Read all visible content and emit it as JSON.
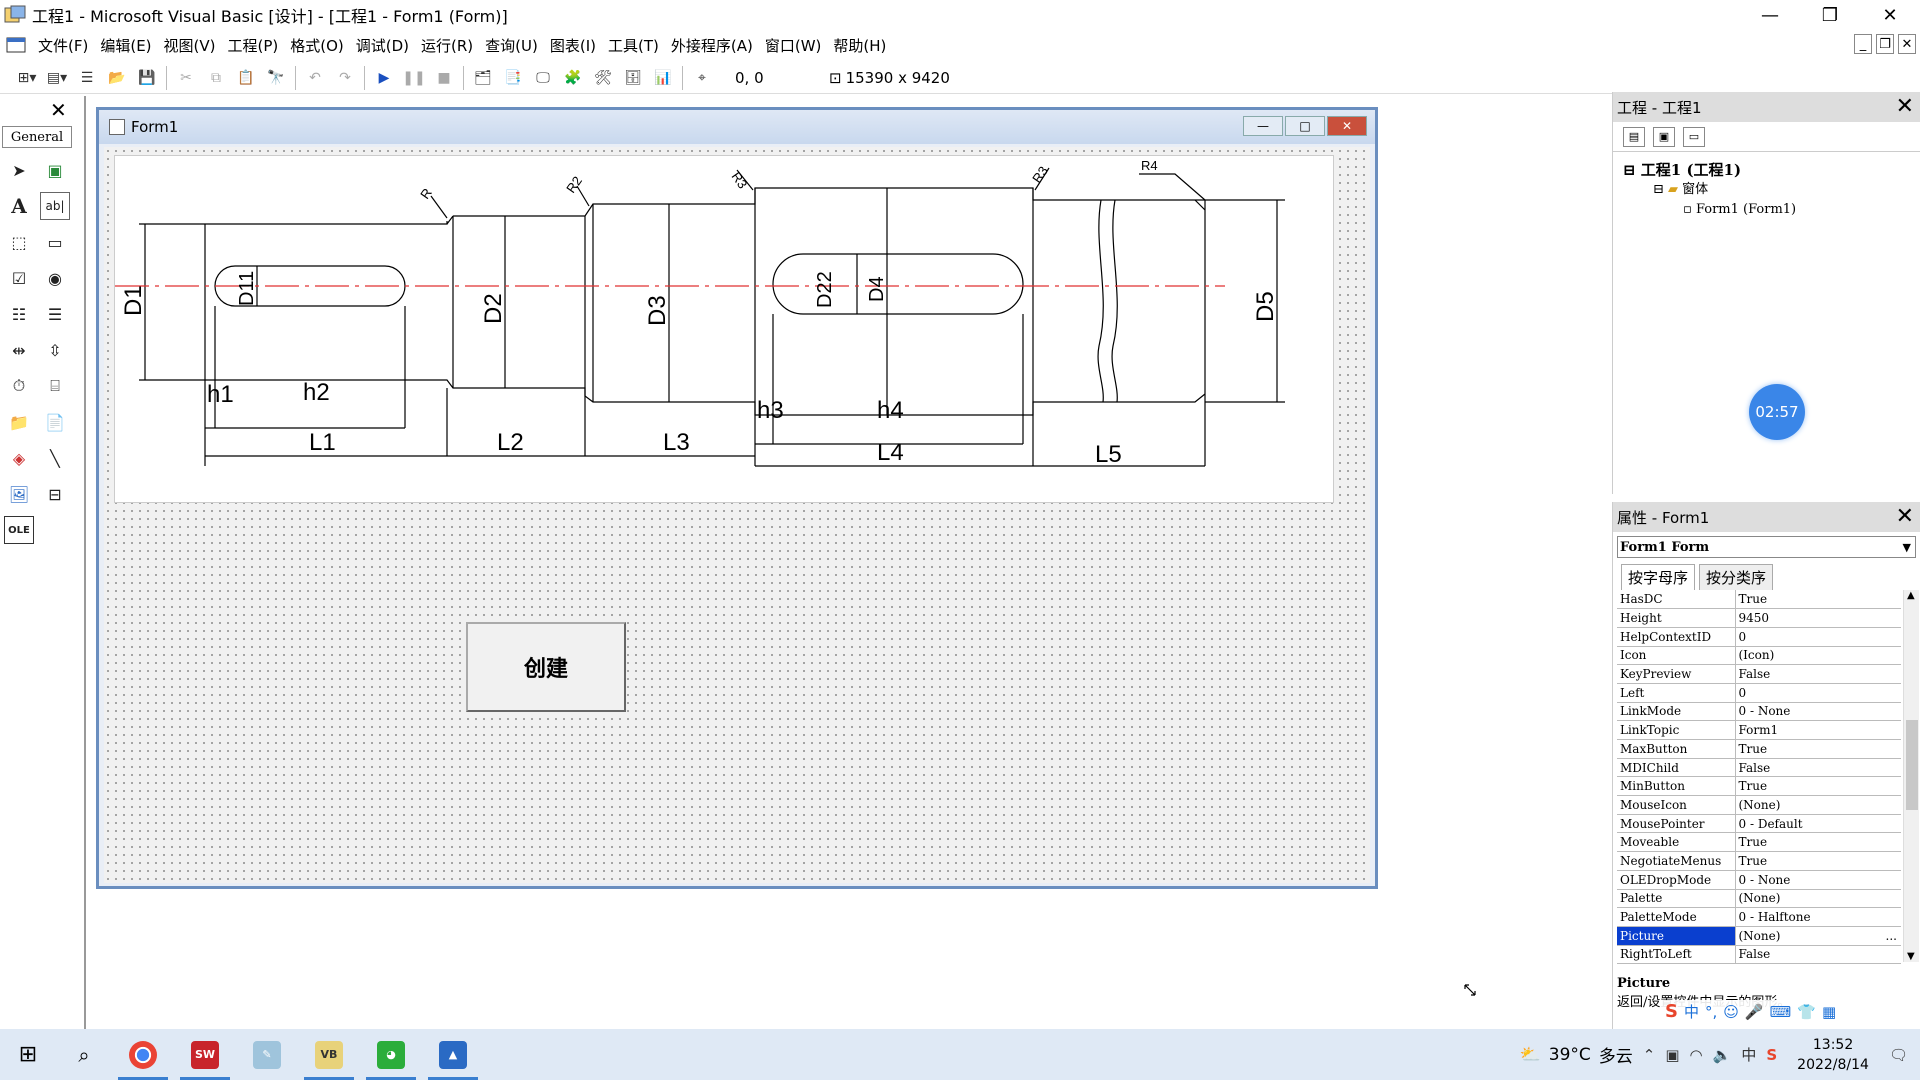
{
  "window": {
    "title": "工程1 - Microsoft Visual Basic [设计] - [工程1 - Form1 (Form)]"
  },
  "menu": [
    "文件(F)",
    "编辑(E)",
    "视图(V)",
    "工程(P)",
    "格式(O)",
    "调试(D)",
    "运行(R)",
    "查询(U)",
    "图表(I)",
    "工具(T)",
    "外接程序(A)",
    "窗口(W)",
    "帮助(H)"
  ],
  "toolbar": {
    "position": "0, 0",
    "size": "15390 x 9420"
  },
  "toolbox": {
    "tab": "General"
  },
  "form": {
    "caption": "Form1",
    "create_button": "创建",
    "drawing_labels": {
      "D1": "D1",
      "D11": "D11",
      "D2": "D2",
      "D3": "D3",
      "D22": "D22",
      "D4": "D4",
      "D5": "D5",
      "h1": "h1",
      "h2": "h2",
      "h3": "h3",
      "h4": "h4",
      "L1": "L1",
      "L2": "L2",
      "L3": "L3",
      "L4": "L4",
      "L5": "L5",
      "R1": "R",
      "R2": "R2",
      "R3a": "R3",
      "R3b": "R3",
      "R4": "R4"
    }
  },
  "project_panel": {
    "title": "工程 - 工程1",
    "tree": {
      "project": "工程1 (工程1)",
      "folder": "窗体",
      "form": "Form1 (Form1)"
    },
    "timer": "02:57"
  },
  "properties_panel": {
    "title": "属性 - Form1",
    "object": "Form1 Form",
    "tabs": [
      "按字母序",
      "按分类序"
    ],
    "rows": [
      {
        "k": "HasDC",
        "v": "True"
      },
      {
        "k": "Height",
        "v": "9450"
      },
      {
        "k": "HelpContextID",
        "v": "0"
      },
      {
        "k": "Icon",
        "v": "(Icon)"
      },
      {
        "k": "KeyPreview",
        "v": "False"
      },
      {
        "k": "Left",
        "v": "0"
      },
      {
        "k": "LinkMode",
        "v": "0 - None"
      },
      {
        "k": "LinkTopic",
        "v": "Form1"
      },
      {
        "k": "MaxButton",
        "v": "True"
      },
      {
        "k": "MDIChild",
        "v": "False"
      },
      {
        "k": "MinButton",
        "v": "True"
      },
      {
        "k": "MouseIcon",
        "v": "(None)"
      },
      {
        "k": "MousePointer",
        "v": "0 - Default"
      },
      {
        "k": "Moveable",
        "v": "True"
      },
      {
        "k": "NegotiateMenus",
        "v": "True"
      },
      {
        "k": "OLEDropMode",
        "v": "0 - None"
      },
      {
        "k": "Palette",
        "v": "(None)"
      },
      {
        "k": "PaletteMode",
        "v": "0 - Halftone"
      },
      {
        "k": "Picture",
        "v": "(None)"
      },
      {
        "k": "RightToLeft",
        "v": "False"
      }
    ],
    "selected": "Picture",
    "desc_title": "Picture",
    "desc_text": "返回/设置控件中显示的图形。",
    "ime": "中"
  },
  "taskbar": {
    "weather_temp": "39°C",
    "weather_text": "多云",
    "ime_indicator": "中",
    "time": "13:52",
    "date": "2022/8/14",
    "apps": [
      "chrome",
      "solidworks",
      "notes",
      "vb6",
      "wechat",
      "photos"
    ]
  },
  "colors": {
    "accent": "#0a3fcf",
    "form_border": "#6a8ebf",
    "centerline": "#e03030",
    "taskbar": "#dfe9f5"
  }
}
